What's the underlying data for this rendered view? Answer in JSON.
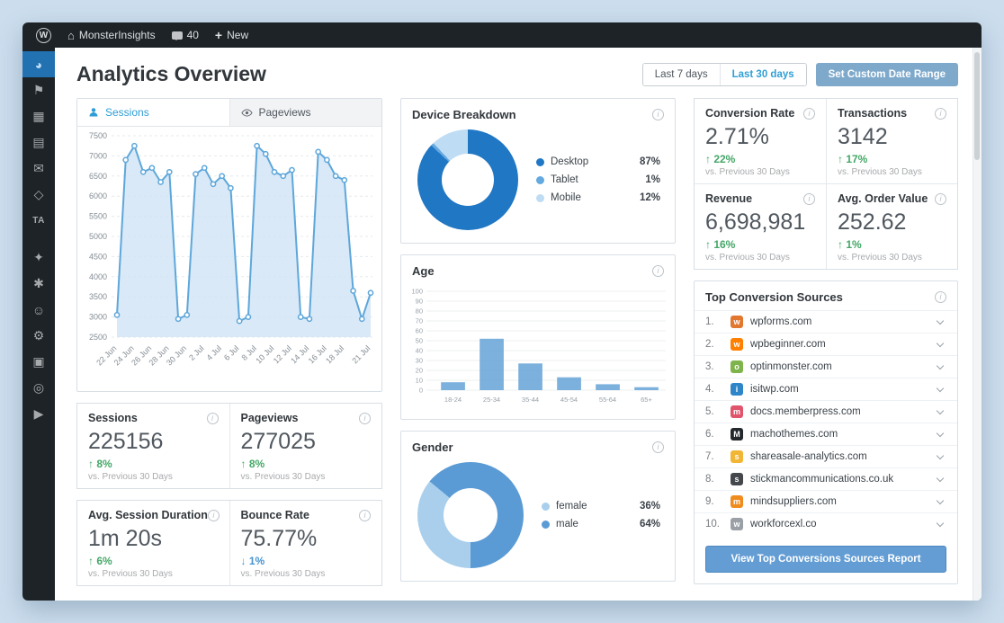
{
  "admin_bar": {
    "site": "MonsterInsights",
    "comments": "40",
    "new": "New"
  },
  "sidebar": {
    "items": [
      {
        "name": "monsterinsights-analytics",
        "glyph": "◕",
        "active": true
      },
      {
        "name": "pin",
        "glyph": "⚑"
      },
      {
        "name": "media",
        "glyph": "▦"
      },
      {
        "name": "pages",
        "glyph": "▤"
      },
      {
        "name": "comments",
        "glyph": "✉"
      },
      {
        "name": "shield",
        "glyph": "◇"
      },
      {
        "name": "ta-plugin",
        "glyph": "TA",
        "small": true
      },
      {
        "name": "tools",
        "glyph": "✦",
        "gap": true
      },
      {
        "name": "plugins",
        "glyph": "✱"
      },
      {
        "name": "users",
        "glyph": "☺"
      },
      {
        "name": "wrench",
        "glyph": "⚙"
      },
      {
        "name": "reports",
        "glyph": "▣"
      },
      {
        "name": "accessibility",
        "glyph": "◎"
      },
      {
        "name": "media-play",
        "glyph": "▶"
      }
    ]
  },
  "header": {
    "title": "Analytics Overview",
    "last7": "Last 7 days",
    "last30": "Last 30 days",
    "custom": "Set Custom Date Range"
  },
  "tabs": {
    "sessions": "Sessions",
    "pageviews": "Pageviews"
  },
  "metrics": {
    "sessions": {
      "label": "Sessions",
      "value": "225156",
      "change": "↑ 8%",
      "change_color": "#44a767",
      "sub": "vs. Previous 30 Days"
    },
    "pageviews": {
      "label": "Pageviews",
      "value": "277025",
      "change": "↑ 8%",
      "change_color": "#44a767",
      "sub": "vs. Previous 30 Days"
    },
    "avg_session_duration": {
      "label": "Avg. Session Duration",
      "value": "1m 20s",
      "change": "↑ 6%",
      "change_color": "#44a767",
      "sub": "vs. Previous 30 Days"
    },
    "bounce_rate": {
      "label": "Bounce Rate",
      "value": "75.77%",
      "change": "↓ 1%",
      "change_color": "#4594d0",
      "sub": "vs. Previous 30 Days"
    },
    "conversion_rate": {
      "label": "Conversion Rate",
      "value": "2.71%",
      "change": "↑ 22%",
      "change_color": "#44a767",
      "sub": "vs. Previous 30 Days"
    },
    "transactions": {
      "label": "Transactions",
      "value": "3142",
      "change": "↑ 17%",
      "change_color": "#44a767",
      "sub": "vs. Previous 30 Days"
    },
    "revenue": {
      "label": "Revenue",
      "value": "6,698,981",
      "change": "↑ 16%",
      "change_color": "#44a767",
      "sub": "vs. Previous 30 Days"
    },
    "avg_order_value": {
      "label": "Avg. Order Value",
      "value": "252.62",
      "change": "↑ 1%",
      "change_color": "#44a767",
      "sub": "vs. Previous 30 Days"
    }
  },
  "chart_data": [
    {
      "type": "line",
      "title": "Sessions",
      "ylim": [
        2500,
        7500
      ],
      "y_step": 500,
      "values": [
        3050,
        6900,
        7250,
        6600,
        6700,
        6350,
        6600,
        2950,
        3050,
        6550,
        6700,
        6300,
        6500,
        6200,
        2900,
        3000,
        7250,
        7050,
        6600,
        6500,
        6650,
        3000,
        2950,
        7100,
        6900,
        6500,
        6400,
        3650,
        2950,
        3600
      ],
      "ticks": [
        {
          "i": 0,
          "label": "22 Jun"
        },
        {
          "i": 2,
          "label": "24 Jun"
        },
        {
          "i": 4,
          "label": "26 Jun"
        },
        {
          "i": 6,
          "label": "28 Jun"
        },
        {
          "i": 8,
          "label": "30 Jun"
        },
        {
          "i": 10,
          "label": "2 Jul"
        },
        {
          "i": 12,
          "label": "4 Jul"
        },
        {
          "i": 14,
          "label": "6 Jul"
        },
        {
          "i": 16,
          "label": "8 Jul"
        },
        {
          "i": 18,
          "label": "10 Jul"
        },
        {
          "i": 20,
          "label": "12 Jul"
        },
        {
          "i": 22,
          "label": "14 Jul"
        },
        {
          "i": 24,
          "label": "16 Jul"
        },
        {
          "i": 26,
          "label": "18 Jul"
        },
        {
          "i": 29,
          "label": "21 Jul"
        }
      ],
      "line_color": "#5ea7da",
      "fill_color": "#cfe4f5",
      "grid": true
    },
    {
      "type": "pie",
      "title": "Device Breakdown",
      "from": 0,
      "segments": [
        {
          "label": "Desktop",
          "value": 87,
          "display": "87%",
          "color": "#2077c4"
        },
        {
          "label": "Tablet",
          "value": 1,
          "display": "1%",
          "color": "#64a9e0"
        },
        {
          "label": "Mobile",
          "value": 12,
          "display": "12%",
          "color": "#bedcf4"
        }
      ]
    },
    {
      "type": "bar",
      "title": "Age",
      "categories": [
        "18-24",
        "25-34",
        "35-44",
        "45-54",
        "55-64",
        "65+"
      ],
      "values": [
        8,
        52,
        27,
        13,
        6,
        3
      ],
      "ylim": [
        0,
        100
      ],
      "y_step": 10,
      "bar_color": "#6aa5d8",
      "grid": true
    },
    {
      "type": "pie",
      "title": "Gender",
      "from": 180,
      "segments": [
        {
          "label": "female",
          "value": 36,
          "display": "36%",
          "color": "#a9cfec"
        },
        {
          "label": "male",
          "value": 64,
          "display": "64%",
          "color": "#5b9bd5"
        }
      ]
    }
  ],
  "top_sources": {
    "title": "Top Conversion Sources",
    "items": [
      {
        "rank": "1.",
        "domain": "wpforms.com",
        "color": "#e27730",
        "initial": "w"
      },
      {
        "rank": "2.",
        "domain": "wpbeginner.com",
        "color": "#ff8000",
        "initial": "w"
      },
      {
        "rank": "3.",
        "domain": "optinmonster.com",
        "color": "#7fb44c",
        "initial": "o"
      },
      {
        "rank": "4.",
        "domain": "isitwp.com",
        "color": "#2e86c8",
        "initial": "i"
      },
      {
        "rank": "5.",
        "domain": "docs.memberpress.com",
        "color": "#e0546c",
        "initial": "m"
      },
      {
        "rank": "6.",
        "domain": "machothemes.com",
        "color": "#23282d",
        "initial": "M"
      },
      {
        "rank": "7.",
        "domain": "shareasale-analytics.com",
        "color": "#f2b636",
        "initial": "s"
      },
      {
        "rank": "8.",
        "domain": "stickmancommunications.co.uk",
        "color": "#44474b",
        "initial": "s"
      },
      {
        "rank": "9.",
        "domain": "mindsuppliers.com",
        "color": "#f08c1e",
        "initial": "m"
      },
      {
        "rank": "10.",
        "domain": "workforcexl.co",
        "color": "#9aa0a6",
        "initial": "w"
      }
    ],
    "button": "View Top Conversions Sources Report"
  }
}
